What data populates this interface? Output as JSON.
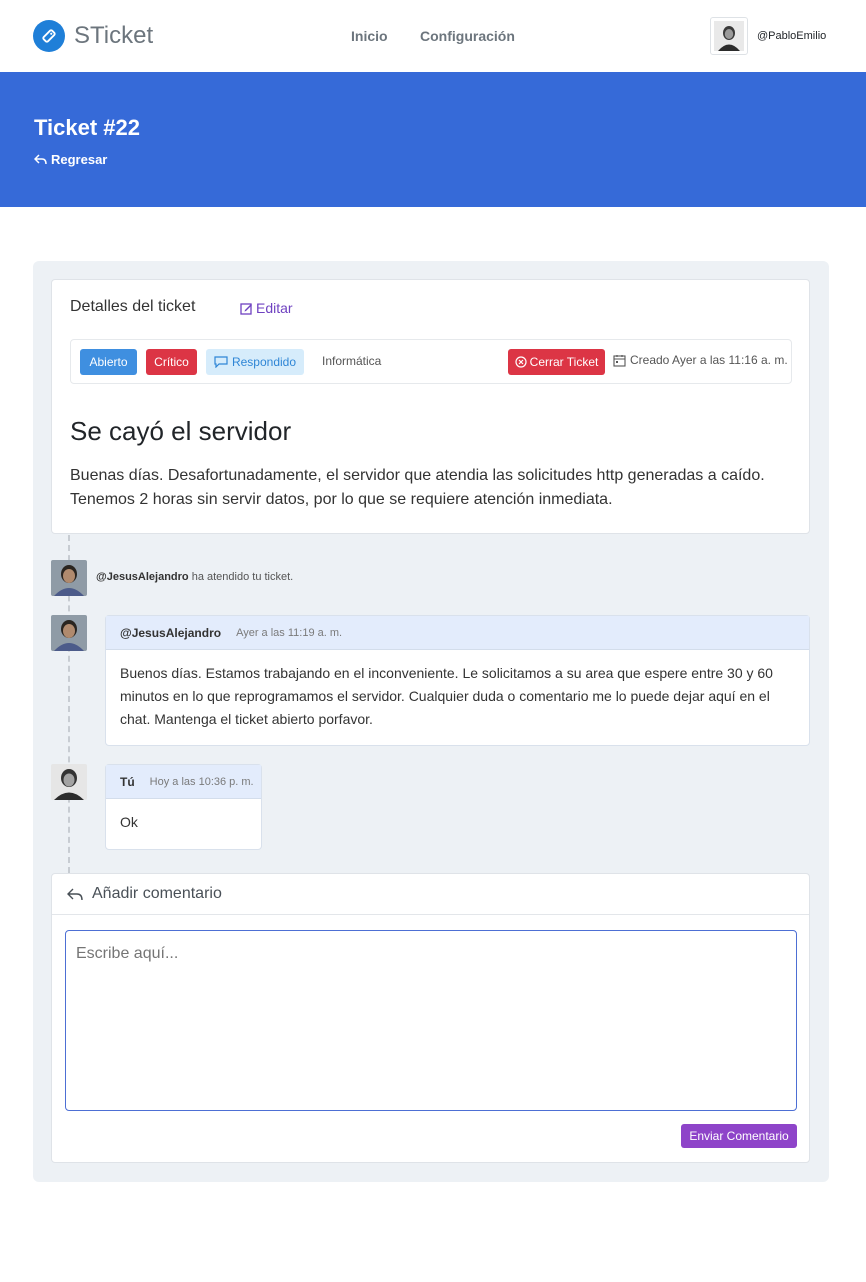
{
  "navbar": {
    "brand": "STicket",
    "links": {
      "inicio": "Inicio",
      "configuracion": "Configuración"
    },
    "user": "@PabloEmilio"
  },
  "hero": {
    "title": "Ticket #22",
    "back": "Regresar"
  },
  "details": {
    "title": "Detalles del ticket",
    "edit": "Editar",
    "badges": {
      "status": "Abierto",
      "priority": "Crítico",
      "state": "Respondido"
    },
    "category": "Informática",
    "close_button": "Cerrar Ticket",
    "created": "Creado Ayer a las 11:16 a. m.",
    "subject": "Se cayó el servidor",
    "description": "Buenas días. Desafortunadamente, el servidor que atendia las solicitudes http generadas a caído. Tenemos 2 horas sin servir datos, por lo que se requiere atención inmediata."
  },
  "timeline": {
    "event": {
      "user": "@JesusAlejandro",
      "text": "ha atendido tu ticket."
    },
    "comments": [
      {
        "author": "@JesusAlejandro",
        "time": "Ayer a las 11:19 a. m.",
        "body": "Buenos días. Estamos trabajando en el inconveniente. Le solicitamos a su area que espere entre 30 y 60 minutos en lo que reprogramamos el servidor. Cualquier duda o comentario me lo puede dejar aquí en el chat. Mantenga el ticket abierto porfavor."
      },
      {
        "author": "Tú",
        "time": "Hoy a las 10:36 p. m.",
        "body": "Ok"
      }
    ]
  },
  "add_comment": {
    "title": "Añadir comentario",
    "placeholder": "Escribe aquí...",
    "value": "",
    "submit": "Enviar Comentario"
  },
  "colors": {
    "primary": "#366ad8",
    "brand_logo": "#1f7fd8",
    "status_open": "#3f8fe0",
    "danger": "#dc3545",
    "responded_bg": "#d6ecfb",
    "accent_purple": "#8e44c9",
    "page_bg": "#edf1f5"
  },
  "icons": {
    "brand": "tag-icon",
    "back": "reply-icon",
    "edit": "edit-icon",
    "responded": "chat-icon",
    "close": "close-circle-icon",
    "created": "calendar-icon",
    "add_comment": "reply-icon"
  }
}
